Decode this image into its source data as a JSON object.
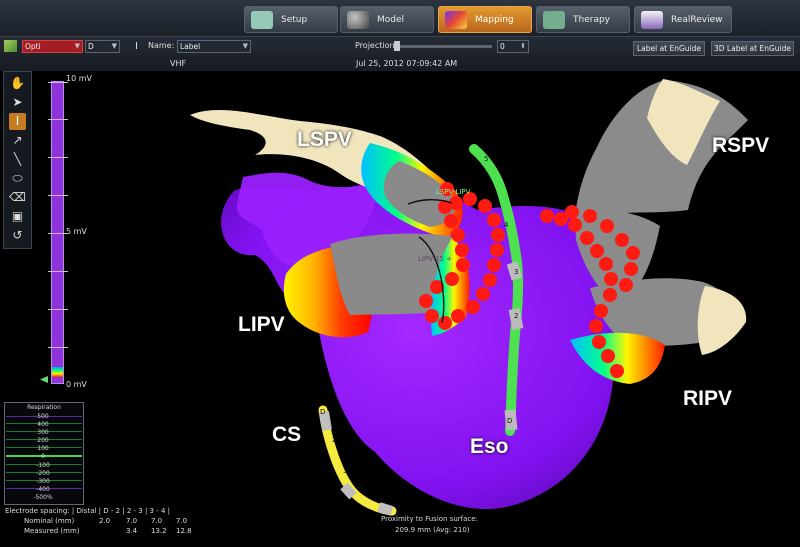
{
  "top_nav": {
    "tabs": [
      {
        "label": "Setup",
        "icon": "setup-icon",
        "active": false
      },
      {
        "label": "Model",
        "icon": "model-icon",
        "active": false
      },
      {
        "label": "Mapping",
        "icon": "mapping-icon",
        "active": true
      },
      {
        "label": "Therapy",
        "icon": "therapy-icon",
        "active": false
      },
      {
        "label": "RealReview",
        "icon": "realreview-icon",
        "active": false
      }
    ]
  },
  "toolbar": {
    "catheter_select": "Opti",
    "mode_select": "D",
    "name_label": "Name:",
    "name_select": "Label",
    "projection_label": "Projection",
    "projection_value": "0",
    "vhf_label": "VHF",
    "timestamp": "Jul 25, 2012 07:09:42 AM",
    "buttons": [
      {
        "label": "Label at EnGuide"
      },
      {
        "label": "3D Label at EnGuide"
      }
    ]
  },
  "scale": {
    "top": "10 mV",
    "middle": "5 mV",
    "bottom": "0 mV"
  },
  "anatomy_labels": {
    "lspv": "LSPV",
    "rspv": "RSPV",
    "lipv": "LIPV",
    "ripv": "RIPV",
    "cs": "CS",
    "eso": "Eso"
  },
  "annotations": {
    "lspv_mark": "LSPV-LIPV",
    "lipv_mark": "LIPV-15 +",
    "cs_d": "D",
    "eso_d": "D",
    "cs_2": "2",
    "cs_3": "3",
    "cs_4": "4",
    "eso_2": "2",
    "eso_3": "3",
    "eso_4": "4",
    "eso_5": "5"
  },
  "respiration": {
    "title": "Respiration",
    "labels": [
      "500",
      "400",
      "300",
      "200",
      "100",
      "0",
      "-100",
      "-200",
      "-300",
      "-400",
      "-500%"
    ]
  },
  "electrode_table": {
    "header": "Electrode spacing: | Distal | D - 2 | 2 - 3 | 3 - 4 |",
    "nominal_label": "Nominal (mm)",
    "nominal_values": [
      "2.0",
      "7.0",
      "7.0",
      "7.0"
    ],
    "measured_label": "Measured (mm)",
    "measured_values": [
      "3.4",
      "13.2",
      "12.8"
    ]
  },
  "proximity": {
    "line1": "Proximity to Fusion surface:",
    "line2": "209.9 mm (Avg: 210)"
  },
  "colors": {
    "accent": "#d98b2a",
    "chamber": "#8b16f0",
    "vein_cap": "#f1e7c5",
    "vein_body": "#8c8c8c",
    "lesion": "#ff1a00",
    "catheter_green": "#43d64b",
    "catheter_yellow": "#f0e43b"
  }
}
